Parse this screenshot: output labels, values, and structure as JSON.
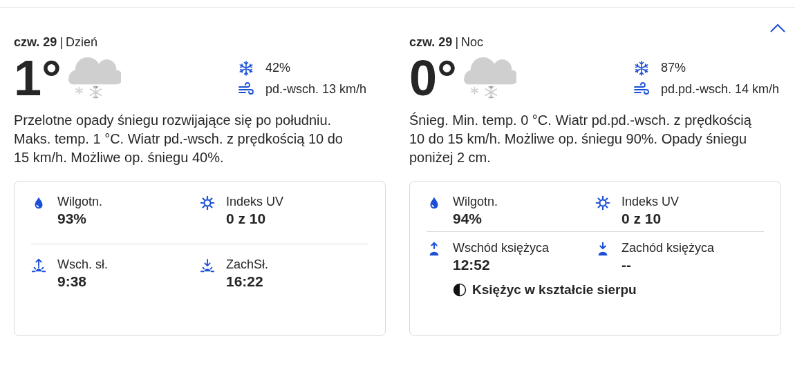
{
  "panel": {
    "expanded": true
  },
  "periods": [
    {
      "date": "czw. 29",
      "separator": "|",
      "part": "Dzień",
      "temperature": "1°",
      "precipitation": "42%",
      "wind": "pd.-wsch. 13 km/h",
      "summary": "Przelotne opady śniegu rozwijające się po południu. Maks. temp. 1 °C. Wiatr pd.-wsch. z prędkością 10 do 15 km/h. Możliwe op. śniegu 40%.",
      "detail_rows": [
        [
          {
            "kind": "humidity",
            "label": "Wilgotn.",
            "value": "93%"
          },
          {
            "kind": "uv",
            "label": "Indeks UV",
            "value": "0 z 10"
          }
        ],
        [
          {
            "kind": "sunrise",
            "label": "Wsch. sł.",
            "value": "9:38"
          },
          {
            "kind": "sunset",
            "label": "ZachSł.",
            "value": "16:22"
          }
        ]
      ]
    },
    {
      "date": "czw. 29",
      "separator": "|",
      "part": "Noc",
      "temperature": "0°",
      "precipitation": "87%",
      "wind": "pd.pd.-wsch. 14 km/h",
      "summary": "Śnieg. Min. temp. 0 °C. Wiatr pd.pd.-wsch. z prędkością 10 do 15 km/h. Możliwe op. śniegu 90%. Opady śniegu poniżej 2 cm.",
      "detail_rows": [
        [
          {
            "kind": "humidity",
            "label": "Wilgotn.",
            "value": "94%"
          },
          {
            "kind": "uv",
            "label": "Indeks UV",
            "value": "0 z 10"
          }
        ],
        [
          {
            "kind": "moonrise",
            "label": "Wschód księżyca",
            "value": "12:52"
          },
          {
            "kind": "moonset",
            "label": "Zachód księżyca",
            "value": "--"
          }
        ]
      ],
      "moon_phase": "Księżyc w kształcie sierpu"
    }
  ]
}
